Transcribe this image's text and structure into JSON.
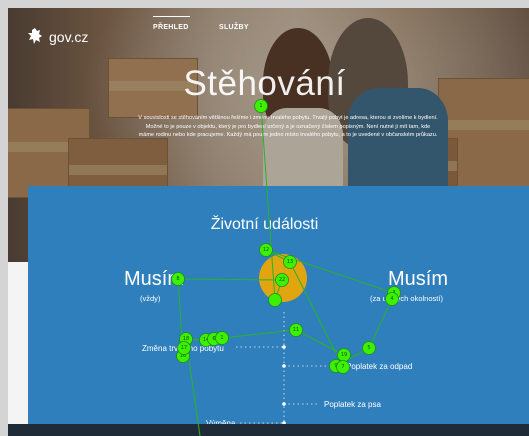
{
  "header": {
    "logo_text": "gov.cz",
    "logo_icon": "lion-icon",
    "nav": [
      {
        "label": "PŘEHLED",
        "active": true
      },
      {
        "label": "SLUŽBY",
        "active": false
      }
    ]
  },
  "hero": {
    "title": "Stěhování",
    "text": "V souvislosti se stěhováním většinou řešíme i změnu trvalého pobytu. Trvalý pobyt je adresa, kterou si zvolíme k bydlení. Možné to je pouze v objektu, který je pro bydlení určený a je označený číslem popisným. Není nutné ji mít tam, kde máme rodinu nebo kde pracujeme. Každý má pouze jedno místo trvalého pobytu, a to je uvedené v občanském průkazu."
  },
  "events": {
    "title": "Životní události",
    "must_left": {
      "label": "Musím",
      "sub": "(vždy)"
    },
    "must_right": {
      "label": "Musím",
      "sub": "(za určitých okolností)"
    },
    "items": [
      {
        "label": "Změna trvalého pobytu"
      },
      {
        "label": "Poplatek za odpad"
      },
      {
        "label": "Poplatek za psa"
      },
      {
        "label": "Výměna"
      }
    ]
  },
  "gaze_overlay": {
    "fixation_color": "#3cf000",
    "highlight_color": "#f0a800",
    "fixations": [
      "1",
      "8",
      "12",
      "13",
      "22",
      "",
      "18",
      "14",
      "6",
      "1",
      "16",
      "17",
      "3",
      "4",
      "5",
      "19",
      "9",
      "7",
      "11"
    ]
  },
  "colors": {
    "section_blue": "#2f7fbc",
    "footer_dark": "#1f2b36"
  }
}
